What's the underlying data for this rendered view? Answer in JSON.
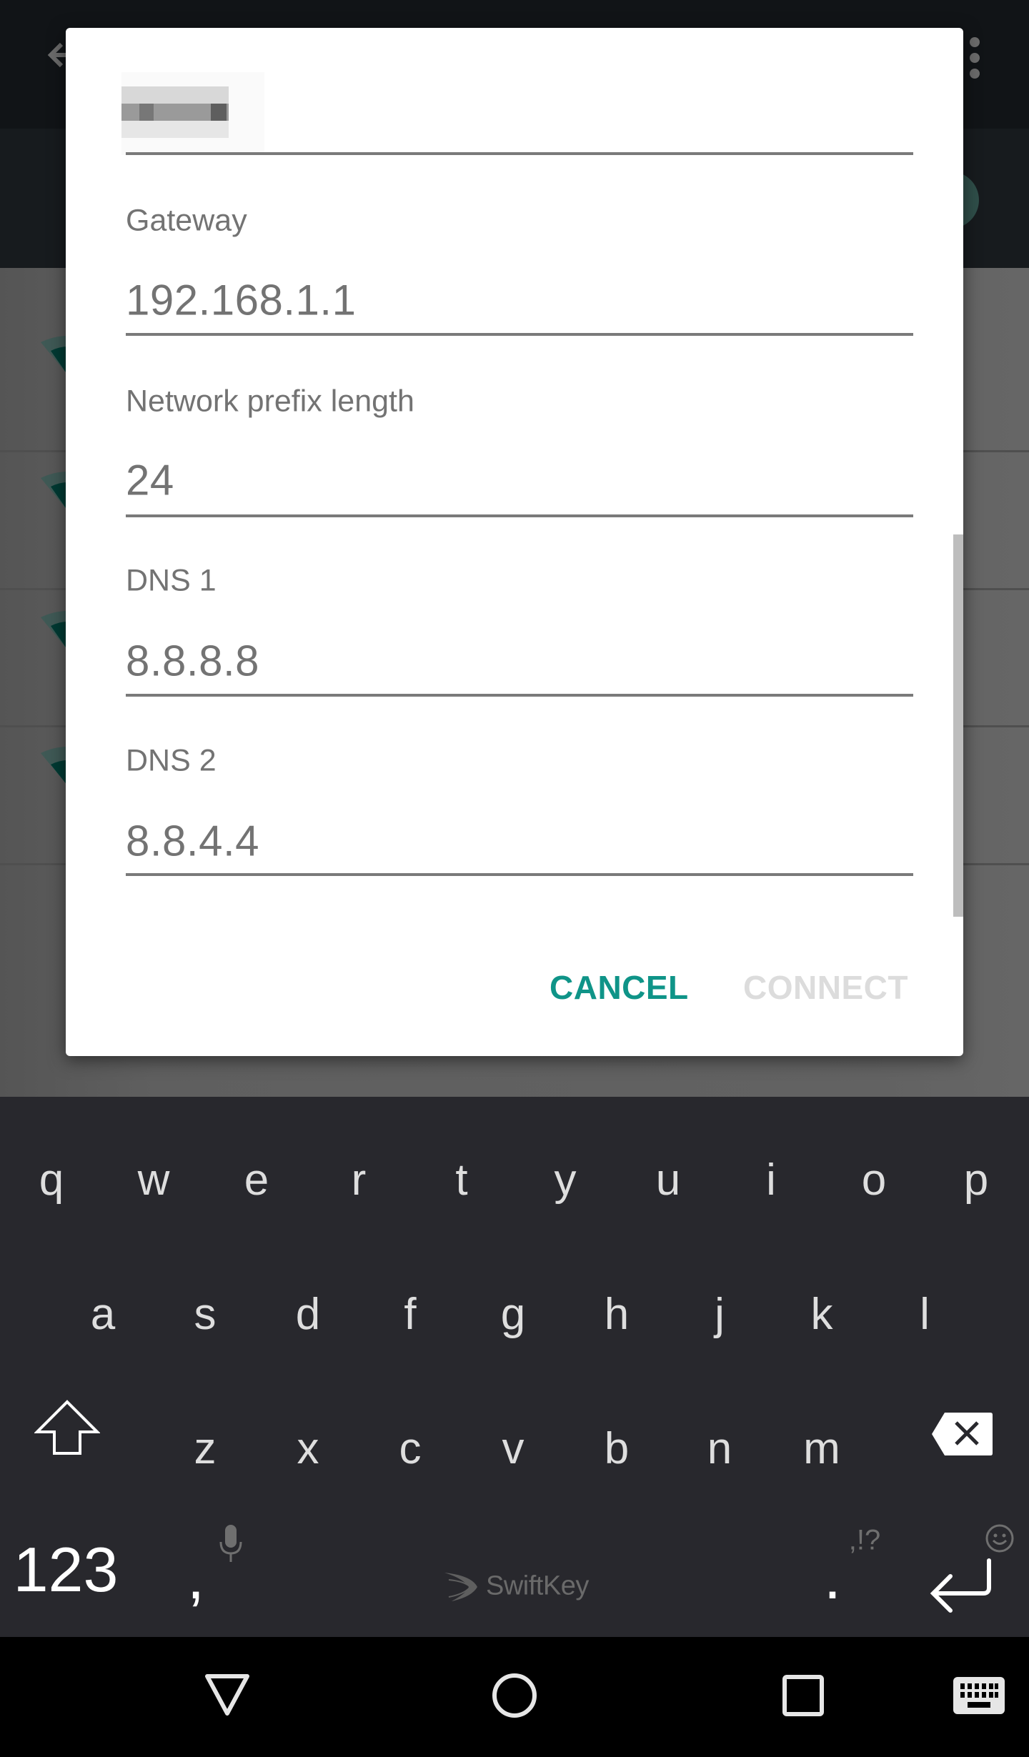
{
  "background_app": {
    "icons": [
      "back-arrow-icon",
      "overflow-menu-icon",
      "wifi-signal-icon"
    ],
    "list_rows": 4
  },
  "dialog": {
    "fields": [
      {
        "label": "",
        "value": "[redacted]",
        "obscured": true
      },
      {
        "label": "Gateway",
        "value": "192.168.1.1"
      },
      {
        "label": "Network prefix length",
        "value": "24"
      },
      {
        "label": "DNS 1",
        "value": "8.8.8.8"
      },
      {
        "label": "DNS 2",
        "value": "8.8.4.4"
      }
    ],
    "buttons": {
      "cancel": "CANCEL",
      "connect": "CONNECT"
    },
    "connect_enabled": false
  },
  "keyboard": {
    "rows": [
      [
        "q",
        "w",
        "e",
        "r",
        "t",
        "y",
        "u",
        "i",
        "o",
        "p"
      ],
      [
        "a",
        "s",
        "d",
        "f",
        "g",
        "h",
        "j",
        "k",
        "l"
      ],
      [
        "z",
        "x",
        "c",
        "v",
        "b",
        "n",
        "m"
      ]
    ],
    "numbers_key": "123",
    "comma_key": ",",
    "period_key": ".",
    "punctuation_hint": ",!?",
    "brand": "SwiftKey"
  },
  "colors": {
    "accent": "#0f9488",
    "disabled": "#dcdcdc",
    "keyboard_bg": "#28282d",
    "text_gray": "#737373"
  }
}
